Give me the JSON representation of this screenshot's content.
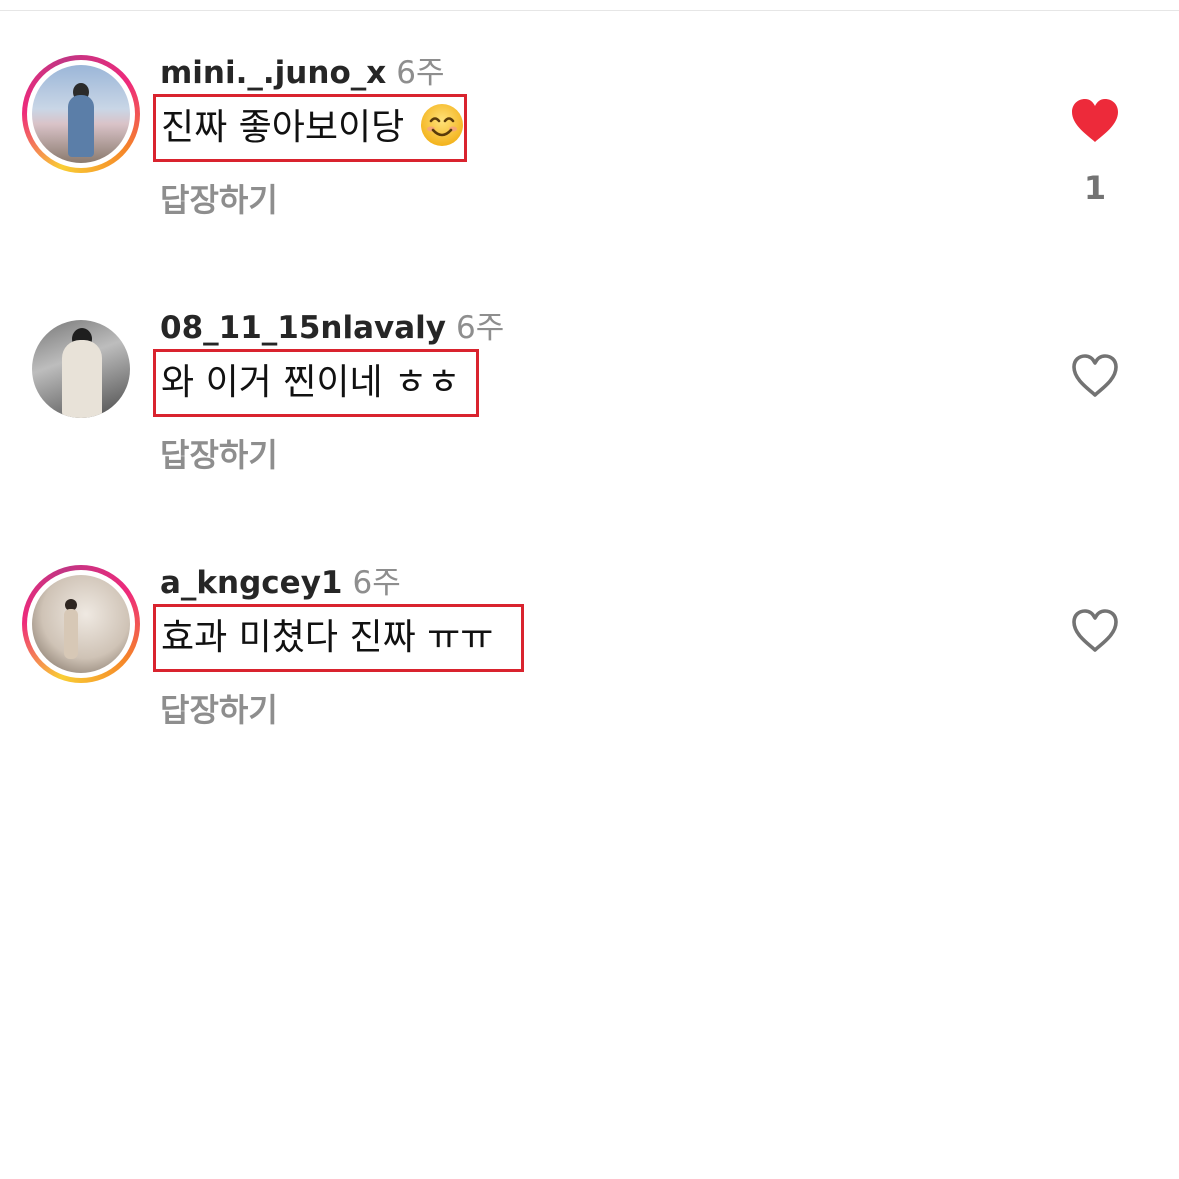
{
  "comments": [
    {
      "username": "mini._.juno_x",
      "time": "6주",
      "text": "진짜 좋아보이당",
      "emoji": "smiling-face-icon",
      "reply_label": "답장하기",
      "liked": true,
      "like_count": "1",
      "avatar_ring": true
    },
    {
      "username": "08_11_15nlavaly",
      "time": "6주",
      "text": "와 이거 찐이네 ㅎㅎ",
      "reply_label": "답장하기",
      "liked": false,
      "avatar_ring": false
    },
    {
      "username": "a_kngcey1",
      "time": "6주",
      "text": "효과 미쳤다 진짜 ㅠㅠ",
      "reply_label": "답장하기",
      "liked": false,
      "avatar_ring": true
    }
  ],
  "colors": {
    "like_red": "#ed4956",
    "highlight_box": "#d9232e",
    "muted_text": "#8e8e8e"
  }
}
